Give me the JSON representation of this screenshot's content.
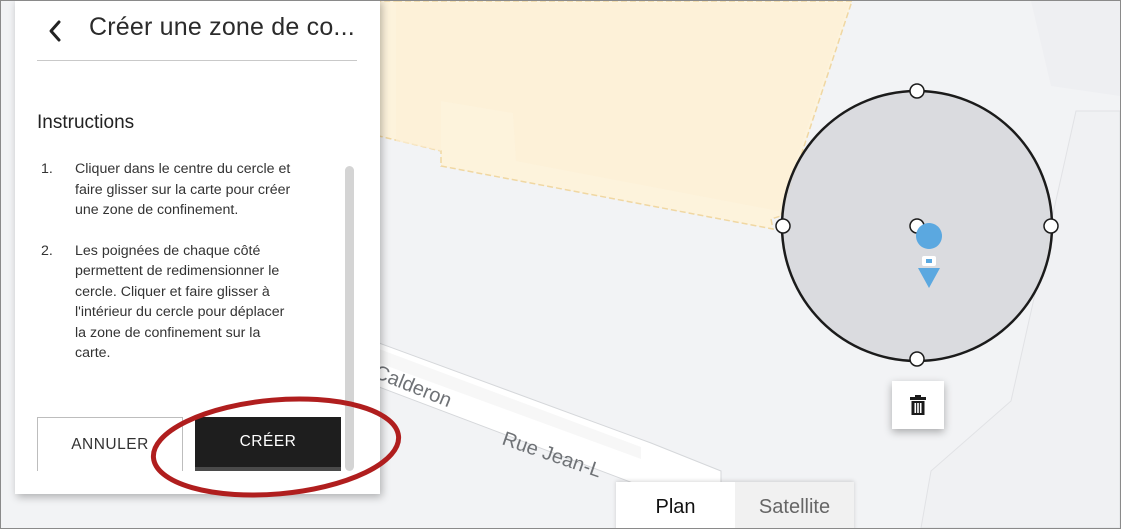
{
  "panel": {
    "title": "Créer une zone de co...",
    "instructions_heading": "Instructions",
    "steps": [
      {
        "number": "1.",
        "lines": [
          "Cliquer dans le centre du cercle et",
          "faire glisser sur la carte pour créer",
          "une zone de confinement."
        ]
      },
      {
        "number": "2.",
        "lines": [
          "Les poignées de chaque côté",
          "permettent de redimensionner le",
          "cercle. Cliquer et faire glisser à",
          "l'intérieur du cercle pour déplacer",
          "la zone de confinement sur la",
          "carte."
        ]
      }
    ],
    "cancel_label": "ANNULER",
    "create_label": "CRÉER"
  },
  "map": {
    "street_label_1": "Calderon",
    "street_label_2": "Rue Jean-L",
    "view_toggle": {
      "plan": "Plan",
      "satellite": "Satellite",
      "selected": "Plan"
    }
  },
  "icons": {
    "back": "chevron-left-icon",
    "delete": "trash-icon",
    "zone_marker": "map-pin-icon"
  },
  "colors": {
    "create_button": "#1e1e1e",
    "circle_fill": "#d8d9dc",
    "marker": "#5ba8e0",
    "building": "#fdf3dc",
    "annotation_ring": "#b01e1e"
  }
}
